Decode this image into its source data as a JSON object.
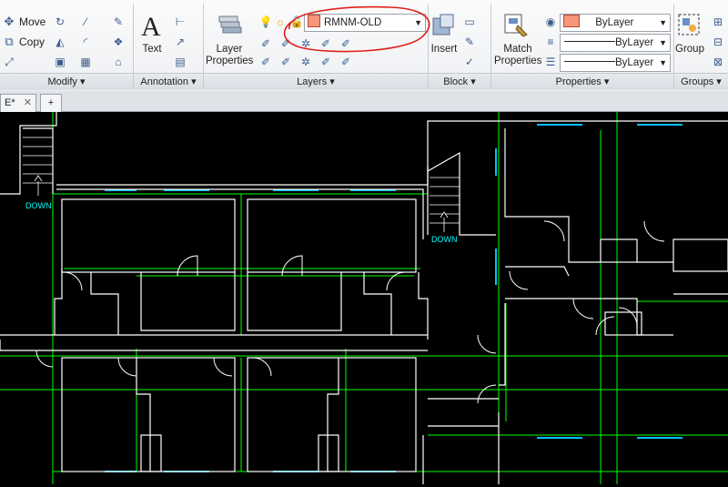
{
  "modify": {
    "move_label": "Move",
    "copy_label": "Copy",
    "panel_label": "Modify"
  },
  "annotation": {
    "text_label": "Text",
    "panel_label": "Annotation"
  },
  "layers": {
    "layer_properties_label": "Layer Properties",
    "current_layer": "RMNM-OLD",
    "panel_label": "Layers"
  },
  "block": {
    "insert_label": "Insert",
    "panel_label": "Block"
  },
  "properties": {
    "match_properties_label": "Match Properties",
    "color_value": "ByLayer",
    "linetype_value": "ByLayer",
    "lineweight_value": "ByLayer",
    "panel_label": "Properties"
  },
  "groups": {
    "group_label": "Group",
    "panel_label": "Groups"
  },
  "tabs": {
    "drawing_tab": "E*",
    "new_tab": "+"
  },
  "drawing": {
    "stair_label_1": "DOWN",
    "stair_label_2": "DOWN"
  },
  "colors": {
    "wall": "#ffffff",
    "grid": "#00ff00",
    "window": "#00c0ff",
    "stair_text": "#00ffff",
    "layer_swatch": "#f6957a",
    "annotation_circle": "#e0201a"
  }
}
